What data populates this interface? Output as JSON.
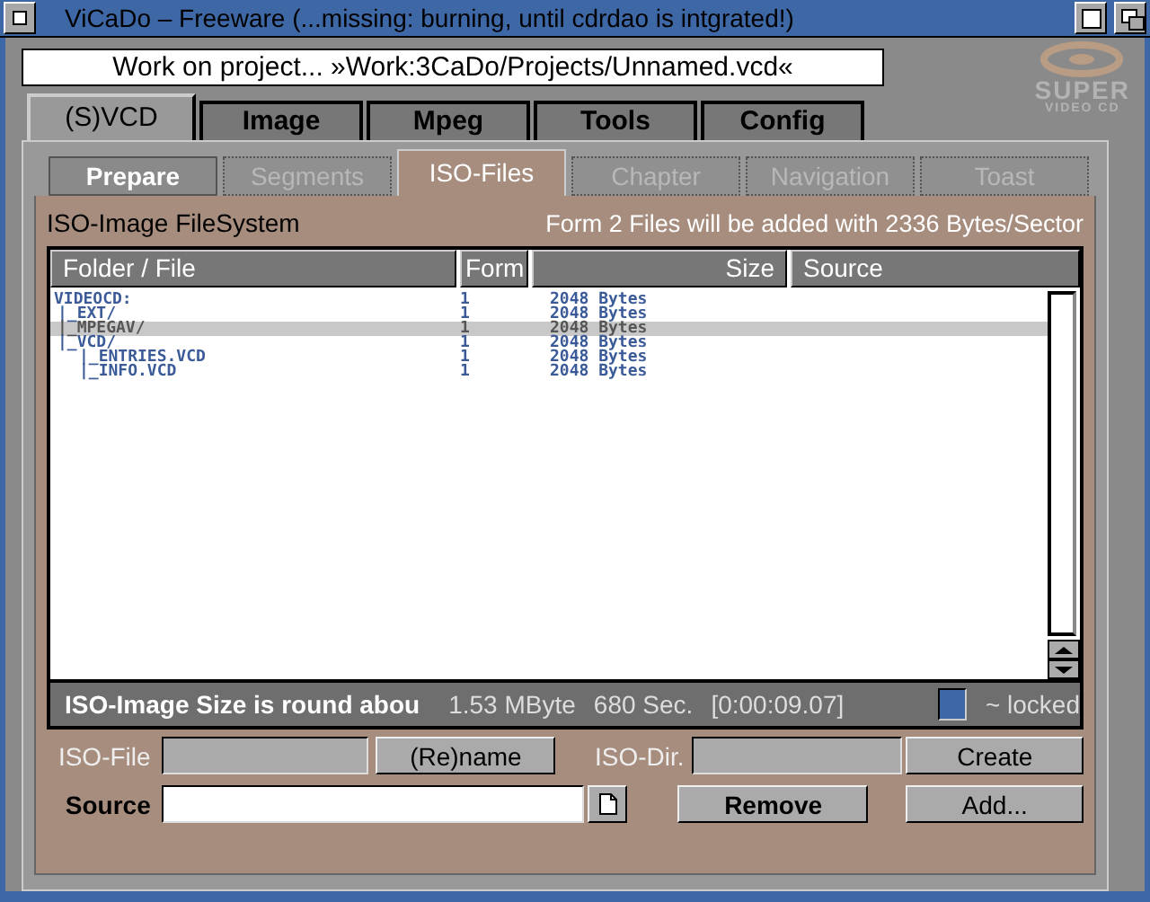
{
  "window": {
    "title": "ViCaDo  –  Freeware (...missing: burning, until cdrdao is intgrated!)"
  },
  "project_field": {
    "value": "Work on project... »Work:3CaDo/Projects/Unnamed.vcd«"
  },
  "logo": {
    "line_1": "SUPER",
    "line_2": "VIDEO CD"
  },
  "tabs": [
    {
      "label": "(S)VCD",
      "selected": true
    },
    {
      "label": "Image",
      "selected": false
    },
    {
      "label": "Mpeg",
      "selected": false
    },
    {
      "label": "Tools",
      "selected": false
    },
    {
      "label": "Config",
      "selected": false
    }
  ],
  "subtabs": [
    {
      "label": "Prepare",
      "selected": false,
      "disabled": false
    },
    {
      "label": "Segments",
      "selected": false,
      "disabled": true
    },
    {
      "label": "ISO-Files",
      "selected": true,
      "disabled": false
    },
    {
      "label": "Chapter",
      "selected": false,
      "disabled": true
    },
    {
      "label": "Navigation",
      "selected": false,
      "disabled": true
    },
    {
      "label": "Toast",
      "selected": false,
      "disabled": true
    }
  ],
  "panel": {
    "title": "ISO-Image FileSystem",
    "info": "Form 2 Files will be added with 2336 Bytes/Sector"
  },
  "table": {
    "columns": [
      "Folder / File",
      "Form",
      "Size",
      "Source"
    ],
    "rows": [
      {
        "name": "VIDEOCD:",
        "form": "1",
        "size": "2048 Bytes",
        "selected": false,
        "children": [
          {
            "name": "|_EXT/",
            "form": "1",
            "size": "2048 Bytes",
            "selected": false
          },
          {
            "name": "|_MPEGAV/",
            "form": "1",
            "size": "2048 Bytes",
            "selected": true
          },
          {
            "name": "|_VCD/",
            "form": "1",
            "size": "2048 Bytes",
            "selected": false,
            "children": [
              {
                "name": "|_ENTRIES.VCD",
                "form": "1",
                "size": "2048 Bytes",
                "selected": false
              },
              {
                "name": "|_INFO.VCD",
                "form": "1",
                "size": "2048 Bytes",
                "selected": false
              }
            ]
          }
        ]
      }
    ]
  },
  "status_bar": {
    "label": "ISO-Image Size is round abou",
    "size": "1.53 MByte",
    "seconds": "680 Sec.",
    "time": "[0:00:09.07]",
    "locked": {
      "label": "~ locked",
      "checked": true
    }
  },
  "form": {
    "iso_file": {
      "label": "ISO-File",
      "disabled": true
    },
    "rename_button": "(Re)name",
    "iso_dir": {
      "label": "ISO-Dir.",
      "disabled": true
    },
    "create_button": "Create",
    "source": {
      "label": "Source",
      "disabled": false
    },
    "remove_button": "Remove",
    "add_button": "Add..."
  }
}
